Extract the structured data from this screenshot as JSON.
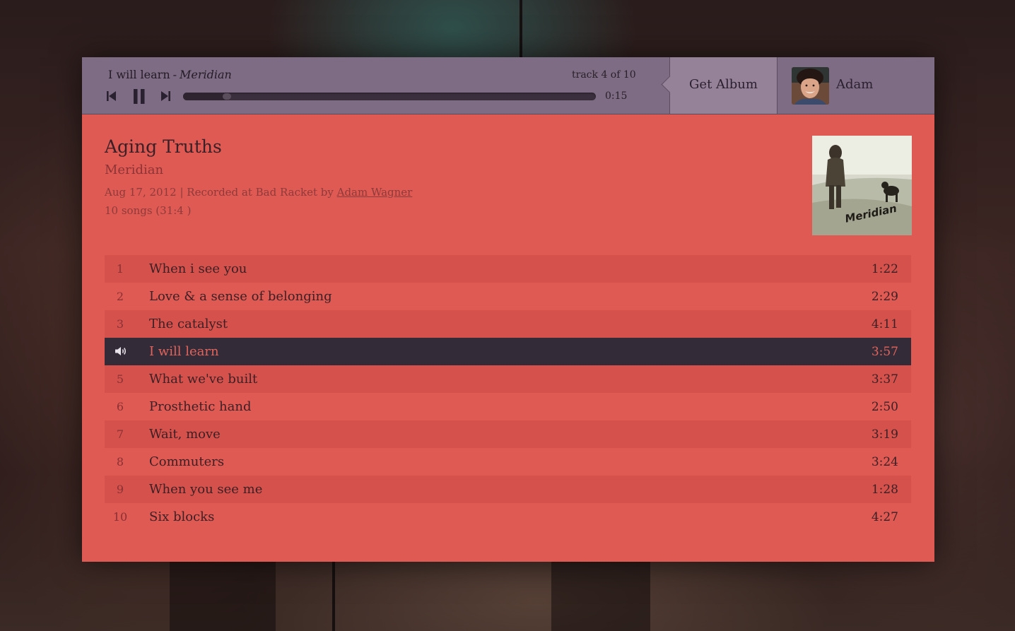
{
  "player": {
    "now_playing_title": "I will learn",
    "now_playing_separator": "-",
    "now_playing_artist": "Meridian",
    "track_counter": "track 4 of 10",
    "elapsed": "0:15",
    "progress_fraction": 0.106,
    "controls": {
      "previous_icon": "skip-back-icon",
      "pause_icon": "pause-icon",
      "next_icon": "skip-forward-icon"
    }
  },
  "header": {
    "get_album_label": "Get Album",
    "user_name": "Adam"
  },
  "album": {
    "title": "Aging Truths",
    "artist": "Meridian",
    "date": "Aug 17, 2012",
    "meta_separator": "|",
    "recorded_prefix": "Recorded at Bad Racket by",
    "recorded_by": "Adam Wagner",
    "song_count": "10 songs (31:4 )",
    "cover_text": "Meridian"
  },
  "tracks": [
    {
      "num": "1",
      "title": "When i see you",
      "duration": "1:22"
    },
    {
      "num": "2",
      "title": "Love & a sense of belonging",
      "duration": "2:29"
    },
    {
      "num": "3",
      "title": "The catalyst",
      "duration": "4:11"
    },
    {
      "num": "4",
      "title": "I will learn",
      "duration": "3:57",
      "playing": true
    },
    {
      "num": "5",
      "title": "What we've built",
      "duration": "3:37"
    },
    {
      "num": "6",
      "title": "Prosthetic hand",
      "duration": "2:50"
    },
    {
      "num": "7",
      "title": "Wait, move",
      "duration": "3:19"
    },
    {
      "num": "8",
      "title": "Commuters",
      "duration": "3:24"
    },
    {
      "num": "9",
      "title": "When you see me",
      "duration": "1:28"
    },
    {
      "num": "10",
      "title": "Six blocks",
      "duration": "4:27"
    }
  ],
  "colors": {
    "topbar": "#7e6c84",
    "get_album_bg": "#958299",
    "content_bg": "#de5a53",
    "row_alt": "#d5524c",
    "playing_row": "#332b38",
    "playing_text": "#e2645b"
  }
}
